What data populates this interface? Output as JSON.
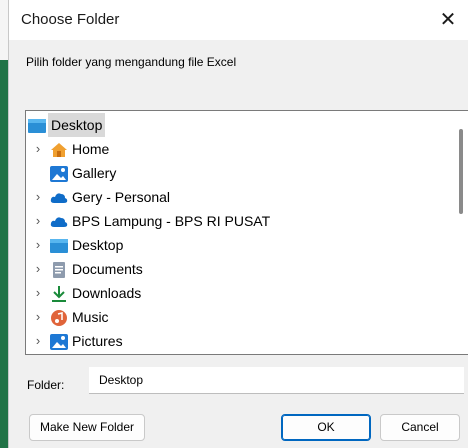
{
  "window": {
    "title": "Choose Folder"
  },
  "instruction": "Pilih folder yang mengandung file Excel",
  "tree": {
    "root": {
      "label": "Desktop",
      "icon": "desktop-icon",
      "selected": true
    },
    "items": [
      {
        "label": "Home",
        "icon": "home-icon",
        "expandable": true
      },
      {
        "label": "Gallery",
        "icon": "gallery-icon",
        "expandable": false
      },
      {
        "label": "Gery - Personal",
        "icon": "onedrive-cloud-icon",
        "expandable": true
      },
      {
        "label": "BPS Lampung - BPS RI PUSAT",
        "icon": "onedrive-cloud-icon",
        "expandable": true
      },
      {
        "label": "Desktop",
        "icon": "desktop-icon",
        "expandable": true
      },
      {
        "label": "Documents",
        "icon": "documents-icon",
        "expandable": true
      },
      {
        "label": "Downloads",
        "icon": "downloads-icon",
        "expandable": true
      },
      {
        "label": "Music",
        "icon": "music-icon",
        "expandable": true
      },
      {
        "label": "Pictures",
        "icon": "pictures-icon",
        "expandable": true
      }
    ]
  },
  "folder": {
    "label": "Folder:",
    "value": "Desktop"
  },
  "buttons": {
    "make_new_folder": "Make New Folder",
    "ok": "OK",
    "cancel": "Cancel"
  },
  "colors": {
    "accent": "#0067c0",
    "selection": "#d9d9d9",
    "dialog_bg": "#f0f0f0"
  }
}
